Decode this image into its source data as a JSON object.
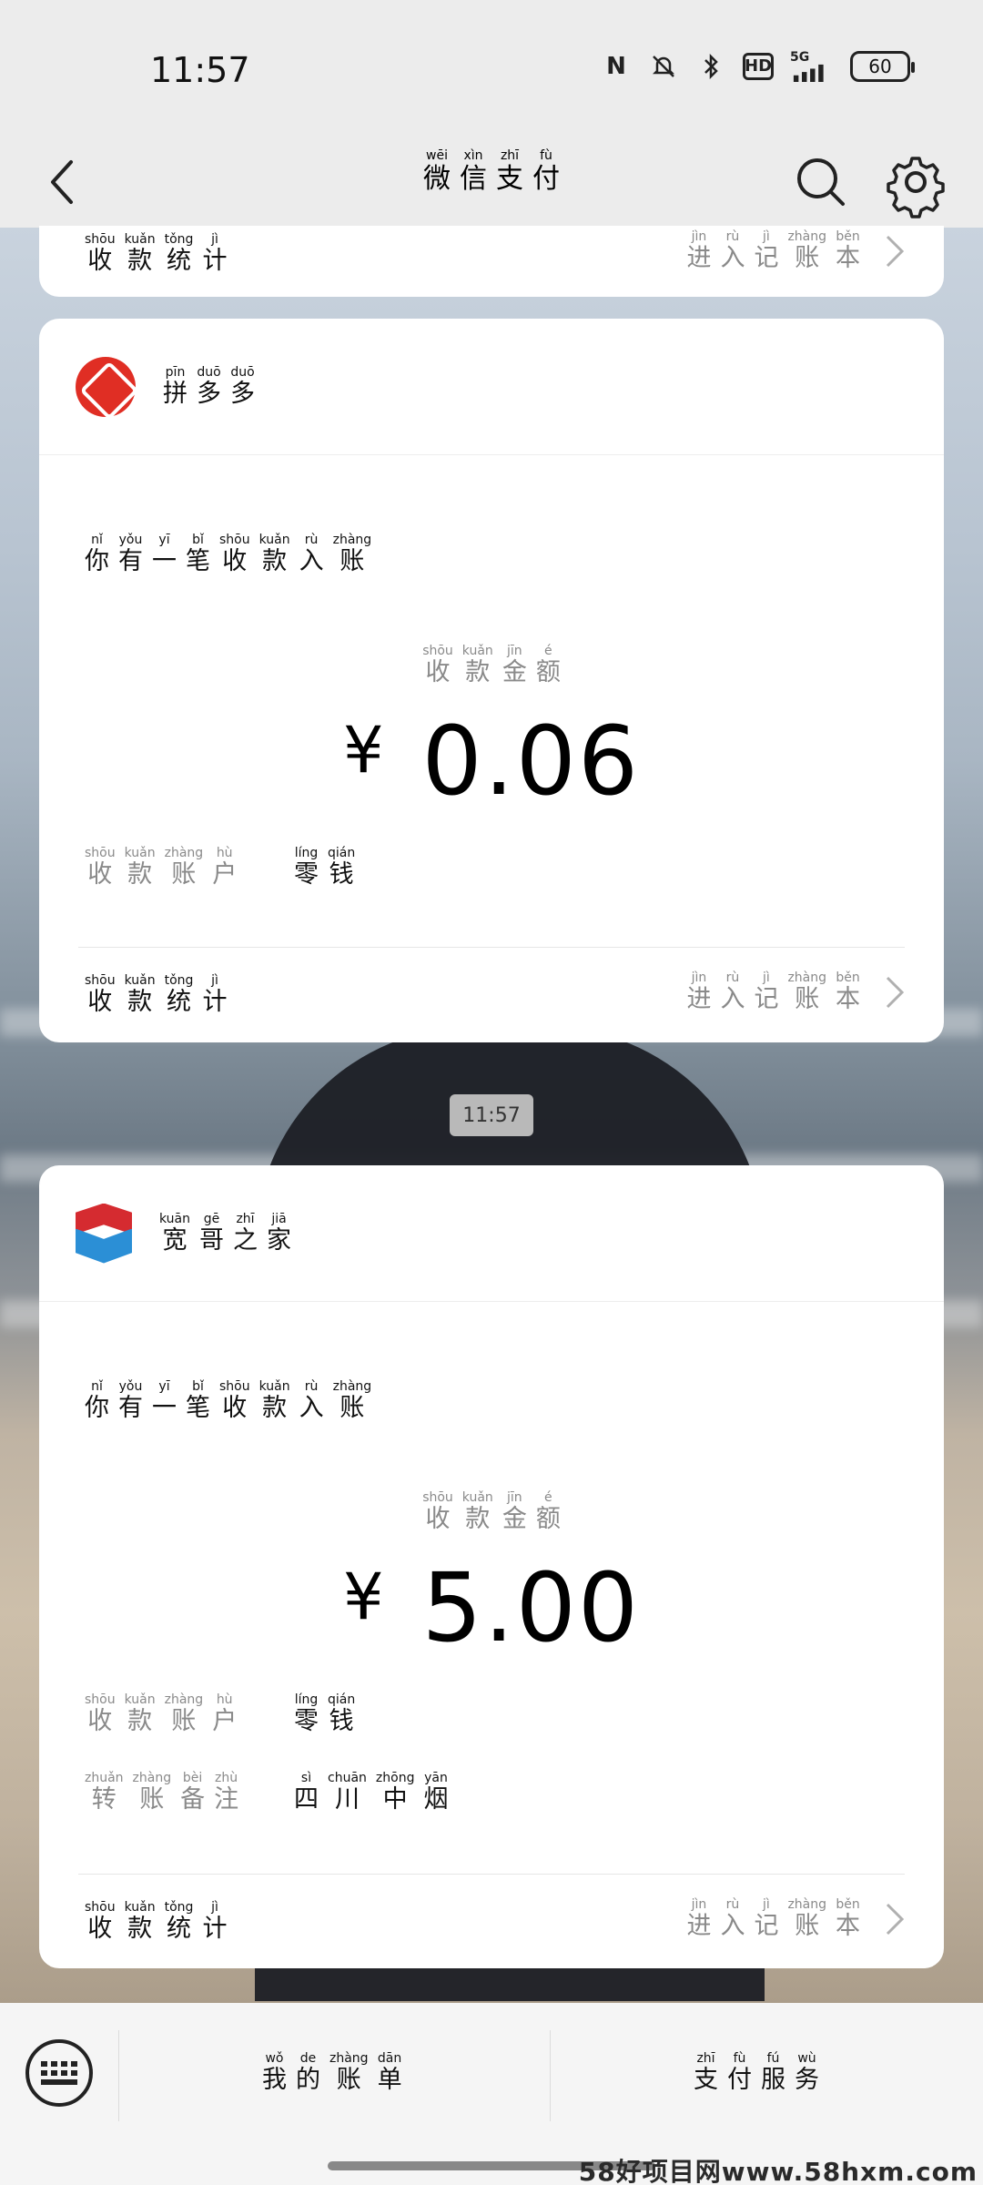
{
  "status_bar": {
    "time": "11:57",
    "nfc": "N",
    "network": "5G",
    "hd": "HD",
    "battery": "60"
  },
  "nav": {
    "title": [
      {
        "py": "wēi",
        "ch": "微"
      },
      {
        "py": "xìn",
        "ch": "信"
      },
      {
        "py": "zhī",
        "ch": "支"
      },
      {
        "py": "fù",
        "ch": "付"
      }
    ]
  },
  "labels": {
    "stats": [
      {
        "py": "shōu",
        "ch": "收"
      },
      {
        "py": "kuǎn",
        "ch": "款"
      },
      {
        "py": "tǒng",
        "ch": "统"
      },
      {
        "py": "jì",
        "ch": "计"
      }
    ],
    "ledger": [
      {
        "py": "jìn",
        "ch": "进"
      },
      {
        "py": "rù",
        "ch": "入"
      },
      {
        "py": "jì",
        "ch": "记"
      },
      {
        "py": "zhàng",
        "ch": "账"
      },
      {
        "py": "běn",
        "ch": "本"
      }
    ],
    "notice": [
      {
        "py": "nǐ",
        "ch": "你"
      },
      {
        "py": "yǒu",
        "ch": "有"
      },
      {
        "py": "yī",
        "ch": "一"
      },
      {
        "py": "bǐ",
        "ch": "笔"
      },
      {
        "py": "shōu",
        "ch": "收"
      },
      {
        "py": "kuǎn",
        "ch": "款"
      },
      {
        "py": "rù",
        "ch": "入"
      },
      {
        "py": "zhàng",
        "ch": "账"
      }
    ],
    "amount_label": [
      {
        "py": "shōu",
        "ch": "收"
      },
      {
        "py": "kuǎn",
        "ch": "款"
      },
      {
        "py": "jīn",
        "ch": "金"
      },
      {
        "py": "é",
        "ch": "额"
      }
    ],
    "account_label": [
      {
        "py": "shōu",
        "ch": "收"
      },
      {
        "py": "kuǎn",
        "ch": "款"
      },
      {
        "py": "zhàng",
        "ch": "账"
      },
      {
        "py": "hù",
        "ch": "户"
      }
    ],
    "account_value": [
      {
        "py": "líng",
        "ch": "零"
      },
      {
        "py": "qián",
        "ch": "钱"
      }
    ],
    "remark_label": [
      {
        "py": "zhuǎn",
        "ch": "转"
      },
      {
        "py": "zhàng",
        "ch": "账"
      },
      {
        "py": "bèi",
        "ch": "备"
      },
      {
        "py": "zhù",
        "ch": "注"
      }
    ]
  },
  "cards": [
    {
      "merchant": [
        {
          "py": "pīn",
          "ch": "拼"
        },
        {
          "py": "duō",
          "ch": "多"
        },
        {
          "py": "duō",
          "ch": "多"
        }
      ],
      "currency": "¥",
      "amount": "0.06"
    },
    {
      "merchant": [
        {
          "py": "kuān",
          "ch": "宽"
        },
        {
          "py": "gē",
          "ch": "哥"
        },
        {
          "py": "zhī",
          "ch": "之"
        },
        {
          "py": "jiā",
          "ch": "家"
        }
      ],
      "currency": "¥",
      "amount": "5.00",
      "remark": [
        {
          "py": "sì",
          "ch": "四"
        },
        {
          "py": "chuān",
          "ch": "川"
        },
        {
          "py": "zhōng",
          "ch": "中"
        },
        {
          "py": "yān",
          "ch": "烟"
        }
      ]
    }
  ],
  "timestamp": "11:57",
  "bottom_bar": {
    "my_bills": [
      {
        "py": "wǒ",
        "ch": "我"
      },
      {
        "py": "de",
        "ch": "的"
      },
      {
        "py": "zhàng",
        "ch": "账"
      },
      {
        "py": "dān",
        "ch": "单"
      }
    ],
    "payment_services": [
      {
        "py": "zhī",
        "ch": "支"
      },
      {
        "py": "fù",
        "ch": "付"
      },
      {
        "py": "fú",
        "ch": "服"
      },
      {
        "py": "wù",
        "ch": "务"
      }
    ]
  },
  "watermark": "58好项目网www.58hxm.com"
}
